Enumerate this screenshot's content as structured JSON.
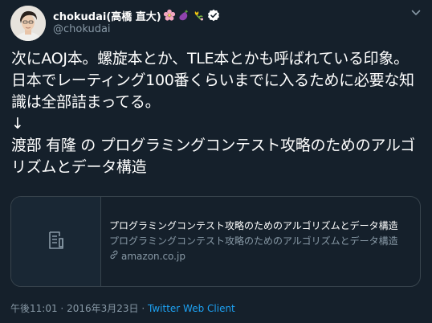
{
  "user": {
    "display_name": "chokudai(高橋 直大)",
    "handle": "@chokudai",
    "emojis": [
      "cherry-blossom-icon",
      "eggplant-icon",
      "tulip-icon"
    ]
  },
  "tweet": {
    "text": "次にAOJ本。螺旋本とか、TLE本とかも呼ばれている印象。日本でレーティング100番くらいまでに入るために必要な知識は全部詰まってる。\n↓\n渡部 有隆 の プログラミングコンテスト攻略のためのアルゴリズムとデータ構造"
  },
  "card": {
    "title": "プログラミングコンテスト攻略のためのアルゴリズムとデータ構造",
    "description": "プログラミングコンテスト攻略のためのアルゴリズムとデータ構造",
    "domain": "amazon.co.jp"
  },
  "meta": {
    "time": "午後11:01",
    "separator1": "·",
    "date": "2016年3月23日",
    "separator2": "·",
    "source": "Twitter Web Client"
  },
  "colors": {
    "background": "#15202b",
    "secondary_text": "#8899a6",
    "link": "#1da1f2",
    "border": "#38444d"
  }
}
